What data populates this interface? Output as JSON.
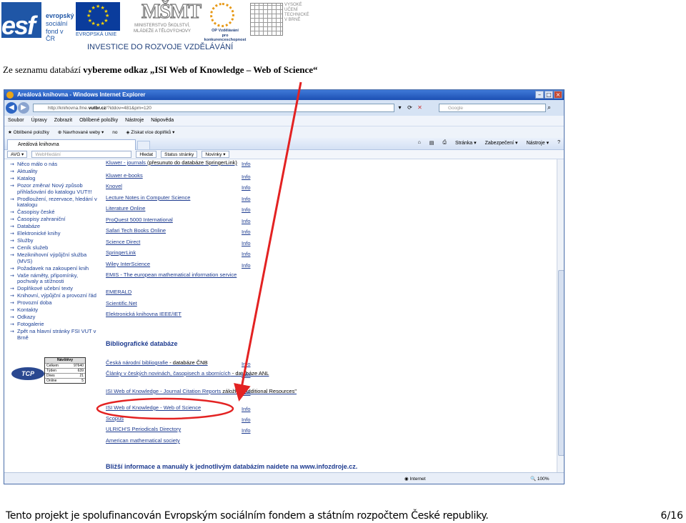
{
  "banner": {
    "esf_logo": "esf",
    "esf_text": [
      "evropský",
      "sociální",
      "fond v ČR"
    ],
    "eu_text": "EVROPSKÁ UNIE",
    "msmt_logo": "MŠMT",
    "msmt_text": [
      "MINISTERSTVO ŠKOLSTVÍ,",
      "MLÁDEŽE A TĚLOVÝCHOVY"
    ],
    "gp_text": [
      "OP Vzdělávání",
      "pro konkurenceschopnost"
    ],
    "vut_text": [
      "VYSOKÉ",
      "UČENÍ",
      "TECHNICKÉ",
      "V BRNĚ"
    ],
    "invest": "INVESTICE DO ROZVOJE VZDĚLÁVÁNÍ"
  },
  "heading": {
    "prefix": "Ze seznamu databází ",
    "bold": "vybereme odkaz „ISI Web of Knowledge – Web of Science“"
  },
  "browser": {
    "title": "Areálová knihovna - Windows Internet Explorer",
    "address_prefix": "http://knihovna.fme.",
    "address_host": "vutbr.cz",
    "address_suffix": "/?iddov=481&pm=120",
    "search_placeholder": "Google",
    "menu": [
      "Soubor",
      "Úpravy",
      "Zobrazit",
      "Oblíbené položky",
      "Nástroje",
      "Nápověda"
    ],
    "favorites": [
      "Oblíbené položky",
      "Navrhované weby ▾",
      "no",
      "Získat více doplňků ▾"
    ],
    "tab_label": "Areálová knihovna",
    "commands": [
      "Stránka ▾",
      "Zabezpečení ▾",
      "Nástroje ▾",
      "?"
    ],
    "toolbar": [
      "AVG ▾",
      "WebHledání",
      "Hledat",
      "Status stránky",
      "Novinky ▾"
    ],
    "status_zone": "Internet",
    "zoom": "100%"
  },
  "sidebar": [
    "Něco málo o nás",
    "Aktuality",
    "Katalog",
    "Pozor změna! Nový způsob přihlašování do katalogu VUT!!!",
    "Prodloužení, rezervace, hledání v katalogu",
    "Časopisy české",
    "Časopisy zahraniční",
    "Databáze",
    "Elektronické knihy",
    "Služby",
    "Ceník služeb",
    "Meziknihovní výpůjční služba (MVS)",
    "Požadavek na zakoupení knih",
    "Vaše náměty, připomínky, pochvaly a stížnosti",
    "Doplňkové učební texty",
    "Knihovní, výpůjční a provozní řád",
    "Provozní doba",
    "Kontakty",
    "Odkazy",
    "Fotogalerie",
    "Zpět na hlavní stránky FSI VUT v Brně"
  ],
  "visits": {
    "title": "Návštěvy",
    "rows": [
      [
        "Celkem",
        "97640"
      ],
      [
        "Týden",
        "639"
      ],
      [
        "Dnes",
        "21"
      ],
      [
        "Online",
        "5"
      ]
    ],
    "badge": "TCP"
  },
  "databases": [
    {
      "name": "Kluwer - journals",
      "extra": " (přesunuto do databáze SpringerLink)",
      "info": "Info"
    },
    {
      "name": "Kluwer e-books",
      "extra": "",
      "info": "Info"
    },
    {
      "name": "Knovel",
      "extra": "",
      "info": "Info"
    },
    {
      "name": "Lecture Notes in Computer Science",
      "extra": "",
      "info": "Info"
    },
    {
      "name": "Literature Online",
      "extra": "",
      "info": "Info"
    },
    {
      "name": "ProQuest 5000 International",
      "extra": "",
      "info": "Info"
    },
    {
      "name": "Safari Tech Books Online",
      "extra": "",
      "info": "Info"
    },
    {
      "name": "Science Direct",
      "extra": "",
      "info": "Info"
    },
    {
      "name": "SpringerLink",
      "extra": "",
      "info": "Info"
    },
    {
      "name": "Wiley InterScience",
      "extra": "",
      "info": "Info"
    },
    {
      "name": "EMIS - The european mathematical information service",
      "extra": "",
      "info": ""
    },
    {
      "name": "EMERALD",
      "extra": "",
      "info": ""
    },
    {
      "name": "Scientific.Net",
      "extra": "",
      "info": ""
    },
    {
      "name": "Elektronická knihovna IEEE/IET",
      "extra": "",
      "info": ""
    }
  ],
  "biblio_heading": "Bibliografické databáze",
  "biblio": [
    {
      "name": "Česká národní bibliografie",
      "extra": " - databáze ČNB",
      "info": "Info"
    },
    {
      "name": "Články v českých novinách, časopisech a sbornících",
      "extra": " - databáze ANL",
      "info": "Info"
    },
    {
      "name": "ISI Web of Knowledge - Journal Citation Reports",
      "extra": " záložka \"Additional Resources\"",
      "info": "Info"
    },
    {
      "name": "ISI Web of Knowledge - Web of Science",
      "extra": "",
      "info": "Info"
    },
    {
      "name": "Scopus",
      "extra": "",
      "info": "Info"
    },
    {
      "name": "ULRICH'S Periodicals Directory",
      "extra": "",
      "info": "Info"
    },
    {
      "name": "American mathematical society",
      "extra": "",
      "info": ""
    }
  ],
  "more_info": "Bližší informace a manuály k jednotlivým databázím naidete na www.infozdroje.cz.",
  "annotation": {
    "color": "#e32222"
  },
  "footer": "Tento projekt je spolufinancován Evropským sociálním fondem a státním rozpočtem České republiky.",
  "page_number": "6/16"
}
